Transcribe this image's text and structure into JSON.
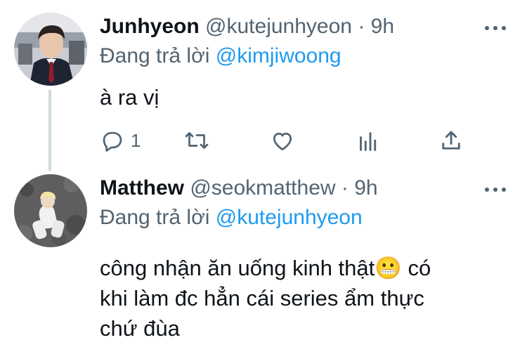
{
  "tweets": [
    {
      "name": "Junhyeon",
      "handle": "@kutejunhyeon",
      "separator": "·",
      "time": "9h",
      "reply_prefix": "Đang trả lời",
      "reply_mention": "@kimjiwoong",
      "text": "à ra vị",
      "reply_count": "1"
    },
    {
      "name": "Matthew",
      "handle": "@seokmatthew",
      "separator": "·",
      "time": "9h",
      "reply_prefix": "Đang trả lời",
      "reply_mention": "@kutejunhyeon",
      "text_line1": "công nhận ăn uống kinh thật",
      "emoji": "😬",
      "text_line1_end": " có",
      "text_line2": "khi làm đc hẳn cái series ẩm thực",
      "text_line3": "chứ đùa"
    }
  ],
  "colors": {
    "text": "#0f1419",
    "secondary": "#536471",
    "mention": "#1d9bf0",
    "thread_line": "#cfd9de"
  },
  "icons": [
    "reply-icon",
    "retweet-icon",
    "like-icon",
    "analytics-icon",
    "share-icon",
    "more-icon"
  ]
}
